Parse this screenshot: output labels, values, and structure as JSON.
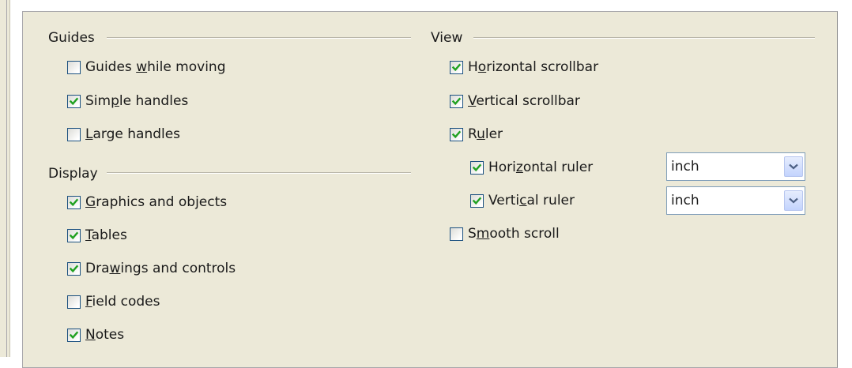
{
  "guides": {
    "title": "Guides",
    "items": [
      {
        "pre": "Guides ",
        "key": "w",
        "post": "hile moving",
        "checked": false
      },
      {
        "pre": "Sim",
        "key": "p",
        "post": "le handles",
        "checked": true
      },
      {
        "pre": "",
        "key": "L",
        "post": "arge handles",
        "checked": false
      }
    ]
  },
  "display": {
    "title": "Display",
    "items": [
      {
        "pre": "",
        "key": "G",
        "post": "raphics and objects",
        "checked": true
      },
      {
        "pre": "",
        "key": "T",
        "post": "ables",
        "checked": true
      },
      {
        "pre": "Dra",
        "key": "w",
        "post": "ings and controls",
        "checked": true
      },
      {
        "pre": "",
        "key": "F",
        "post": "ield codes",
        "checked": false
      },
      {
        "pre": "",
        "key": "N",
        "post": "otes",
        "checked": true
      }
    ]
  },
  "view": {
    "title": "View",
    "items": [
      {
        "pre": "H",
        "key": "o",
        "post": "rizontal scrollbar",
        "checked": true
      },
      {
        "pre": "",
        "key": "V",
        "post": "ertical scrollbar",
        "checked": true
      },
      {
        "pre": "R",
        "key": "u",
        "post": "ler",
        "checked": true
      },
      {
        "pre": "Hori",
        "key": "z",
        "post": "ontal ruler",
        "checked": true
      },
      {
        "pre": "Verti",
        "key": "c",
        "post": "al ruler",
        "checked": true
      },
      {
        "pre": "S",
        "key": "m",
        "post": "ooth scroll",
        "checked": false
      }
    ],
    "horizontal_ruler_unit": "inch",
    "vertical_ruler_unit": "inch"
  },
  "colors": {
    "panel_bg": "#ece9d8",
    "check_green": "#21a121",
    "checkbox_border": "#1c5180"
  }
}
